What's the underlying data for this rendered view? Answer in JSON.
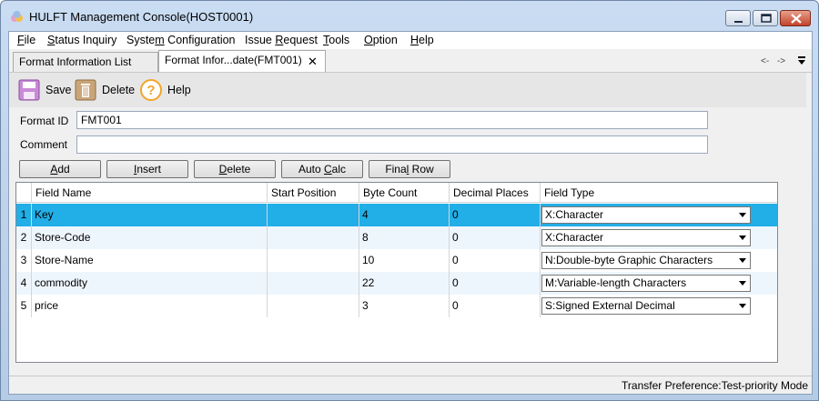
{
  "window": {
    "title": "HULFT Management Console(HOST0001)"
  },
  "menu": [
    {
      "pre": "",
      "key": "F",
      "post": "ile"
    },
    {
      "pre": "",
      "key": "S",
      "post": "tatus Inquiry"
    },
    {
      "pre": "Syste",
      "key": "m",
      "post": " Configuration"
    },
    {
      "pre": "Issue ",
      "key": "R",
      "post": "equest"
    },
    {
      "pre": "",
      "key": "T",
      "post": "ools"
    },
    {
      "pre": "",
      "key": "O",
      "post": "ption"
    },
    {
      "pre": "",
      "key": "H",
      "post": "elp"
    }
  ],
  "tabs": [
    {
      "label": "Format Information List"
    },
    {
      "label": "Format Infor...date(FMT001)"
    }
  ],
  "tab_close_glyph": "✕",
  "nav": {
    "back": "<-",
    "forward": "->"
  },
  "toolbar": {
    "save": "Save",
    "delete": "Delete",
    "help": "Help"
  },
  "form": {
    "format_id_label": "Format ID",
    "format_id_value": "FMT001",
    "comment_label": "Comment",
    "comment_value": ""
  },
  "buttons": [
    {
      "pre": "",
      "key": "A",
      "post": "dd"
    },
    {
      "pre": "",
      "key": "I",
      "post": "nsert"
    },
    {
      "pre": "",
      "key": "D",
      "post": "elete"
    },
    {
      "pre": "Auto ",
      "key": "C",
      "post": "alc"
    },
    {
      "pre": "Fina",
      "key": "l",
      "post": " Row"
    }
  ],
  "grid": {
    "columns": [
      "Field Name",
      "Start Position",
      "Byte Count",
      "Decimal Places",
      "Field Type"
    ],
    "rows": [
      {
        "num": "1",
        "name": "Key",
        "start": "",
        "bytes": "4",
        "decimals": "0",
        "type": "X:Character"
      },
      {
        "num": "2",
        "name": "Store-Code",
        "start": "",
        "bytes": "8",
        "decimals": "0",
        "type": "X:Character"
      },
      {
        "num": "3",
        "name": "Store-Name",
        "start": "",
        "bytes": "10",
        "decimals": "0",
        "type": "N:Double-byte Graphic Characters"
      },
      {
        "num": "4",
        "name": "commodity",
        "start": "",
        "bytes": "22",
        "decimals": "0",
        "type": "M:Variable-length Characters"
      },
      {
        "num": "5",
        "name": "price",
        "start": "",
        "bytes": "3",
        "decimals": "0",
        "type": "S:Signed External Decimal"
      }
    ]
  },
  "status": {
    "text": "Transfer Preference:Test-priority Mode"
  },
  "colors": {
    "selected_row": "#22aee6",
    "alt_row": "#eef6fd"
  },
  "icons": {
    "app": "hulft-app-icon",
    "save": "floppy-disk-icon",
    "delete": "trash-can-icon",
    "help": "help-question-icon"
  }
}
